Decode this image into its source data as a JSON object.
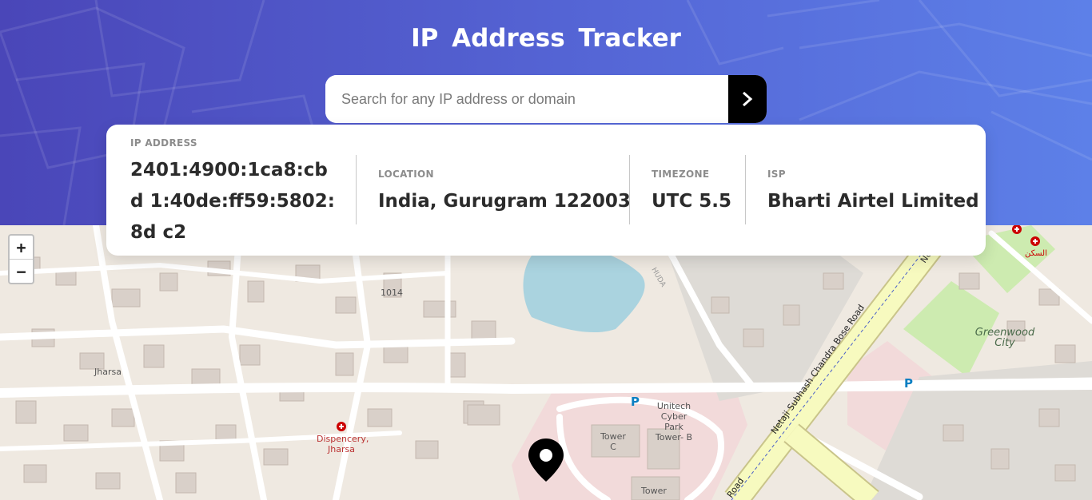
{
  "header": {
    "title": "IP Address Tracker"
  },
  "search": {
    "placeholder": "Search for any IP address or domain",
    "value": "",
    "submit_icon": "chevron-right-icon"
  },
  "info": {
    "ip": {
      "label": "IP ADDRESS",
      "value": "2401:4900:1ca8:cbd 1:40de:ff59:5802:8d c2"
    },
    "location": {
      "label": "LOCATION",
      "value": "India, Gurugram 122003"
    },
    "timezone": {
      "label": "TIMEZONE",
      "value": "UTC 5.5"
    },
    "isp": {
      "label": "ISP",
      "value": "Bharti Airtel Limited"
    }
  },
  "map": {
    "zoom_in": "+",
    "zoom_out": "−",
    "labels": {
      "jharsa": "Jharsa",
      "dispencery": "Dispencery, Jharsa",
      "unitech": "Unitech Cyber Park Tower- B",
      "tower_c": "Tower C",
      "tower": "Tower",
      "greenwood": "Greenwood City",
      "road": "Netaji Subhash Chandra Bose Road",
      "road_short": "Road",
      "num_1014": "1014",
      "huda": "HUDA",
      "arabic": "السكن",
      "parking": "P",
      "ne": "Ne"
    },
    "colors": {
      "base": "#efe9e1",
      "water": "#aad3df",
      "park": "#cdebb0",
      "building": "#d9d0c9",
      "commercial": "#f2dada",
      "trunk": "#f7fabf"
    }
  },
  "colors": {
    "header_start": "#4a46b8",
    "header_end": "#5d80e8",
    "button": "#000000"
  }
}
